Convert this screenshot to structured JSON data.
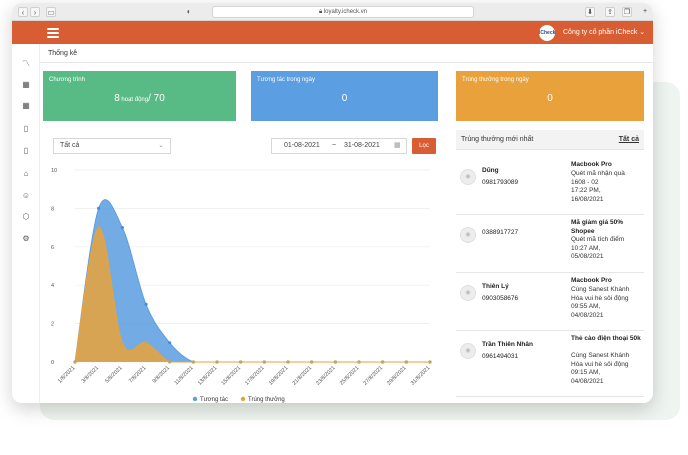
{
  "browser": {
    "url": "loyalty.icheck.vn"
  },
  "header": {
    "avatar_text": "iCheck",
    "company": "Công ty cổ phần iCheck ⌄"
  },
  "page": {
    "breadcrumb": "Thống kê"
  },
  "stats": [
    {
      "title": "Chương trình",
      "value": "8",
      "unit": " hoạt động",
      "suffix": "/ 70",
      "color": "#58bb85"
    },
    {
      "title": "Tương tác trong ngày",
      "value": "0",
      "color": "#5b9ee1"
    },
    {
      "title": "Trúng thưởng trong ngày",
      "value": "0",
      "color": "#e9a23b"
    }
  ],
  "filter": {
    "program_select": "Tất cả",
    "date_from": "01-08-2021",
    "date_sep": "~",
    "date_to": "31-08-2021",
    "filter_button": "Lọc"
  },
  "chart_data": {
    "type": "area",
    "x": [
      "1/8/2021",
      "3/8/2021",
      "5/8/2021",
      "7/8/2021",
      "9/8/2021",
      "11/8/2021",
      "13/8/2021",
      "15/8/2021",
      "17/8/2021",
      "19/8/2021",
      "21/8/2021",
      "23/8/2021",
      "25/8/2021",
      "27/8/2021",
      "29/8/2021",
      "31/8/2021"
    ],
    "x_tick_labels": [
      "1/8/2021",
      "3/8/2021",
      "5/8/2021",
      "7/8/2021",
      "9/8/2021",
      "11/8/2021",
      "13/8/2021",
      "15/8/2021",
      "17/8/2021",
      "19/8/2021",
      "21/8/2021",
      "23/8/2021",
      "25/8/2021",
      "27/8/2021",
      "29/8/2021",
      "31/8/2021"
    ],
    "series": [
      {
        "name": "Tương tác",
        "color": "#5b9ee1",
        "values": [
          0,
          8,
          7,
          3,
          1,
          0,
          0,
          0,
          0,
          0,
          0,
          0,
          0,
          0,
          0,
          0
        ]
      },
      {
        "name": "Trúng thưởng",
        "color": "#e9a23b",
        "values": [
          0,
          7,
          1,
          1,
          0,
          0,
          0,
          0,
          0,
          0,
          0,
          0,
          0,
          0,
          0,
          0
        ]
      }
    ],
    "ylim": [
      0,
      10
    ],
    "yticks": [
      0,
      2,
      4,
      6,
      8,
      10
    ],
    "grid": true,
    "legend": "bottom"
  },
  "winners": {
    "title": "Trúng thưởng mới nhất",
    "view_all": "Tất cả",
    "items": [
      {
        "name": "Dũng",
        "phone": "0981793089",
        "prize": "Macbook Pro",
        "desc": [
          "Quét mã nhận quà",
          "1608 - 02",
          "17:22 PM,",
          "16/08/2021"
        ]
      },
      {
        "name": "",
        "phone": "0388917727",
        "prize": "Mã giảm giá 50% Shopee",
        "desc": [
          "Quét mã tích điểm",
          "10:27 AM,",
          "05/08/2021"
        ]
      },
      {
        "name": "Thiên Lý",
        "phone": "0903058676",
        "prize": "Macbook Pro",
        "desc": [
          "Cùng Sanest Khánh",
          "Hòa vui hè sôi động",
          "09:55 AM,",
          "04/08/2021"
        ]
      },
      {
        "name": "Trần Thiên Nhân",
        "phone": "0961494031",
        "prize": "Thẻ cào điện thoại 50k",
        "desc": [
          "Cùng Sanest Khánh",
          "Hòa vui hè sôi động",
          "09:15 AM,",
          "04/08/2021"
        ]
      }
    ]
  }
}
